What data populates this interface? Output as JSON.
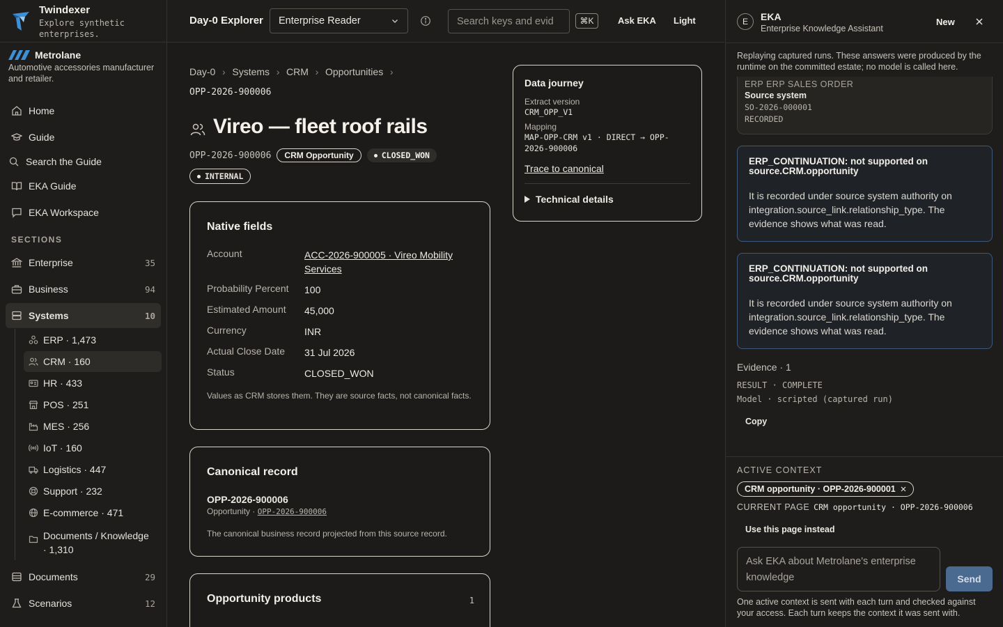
{
  "brand": {
    "name": "Twindexer",
    "tagline": "Explore synthetic enterprises."
  },
  "org": {
    "name": "Metrolane",
    "description": "Automotive accessories manufacturer and retailer."
  },
  "nav": {
    "home": "Home",
    "guide": "Guide",
    "search_guide": "Search the Guide",
    "eka_guide": "EKA Guide",
    "eka_workspace": "EKA Workspace",
    "sections_label": "SECTIONS",
    "enterprise": {
      "label": "Enterprise",
      "count": "35"
    },
    "business": {
      "label": "Business",
      "count": "94"
    },
    "systems": {
      "label": "Systems",
      "count": "10"
    },
    "documents": {
      "label": "Documents",
      "count": "29"
    },
    "scenarios": {
      "label": "Scenarios",
      "count": "12"
    },
    "systems_children": [
      {
        "label": "ERP · 1,473",
        "icon": "network-icon"
      },
      {
        "label": "CRM · 160",
        "icon": "users-icon"
      },
      {
        "label": "HR · 433",
        "icon": "id-card-icon"
      },
      {
        "label": "POS · 251",
        "icon": "store-icon"
      },
      {
        "label": "MES · 256",
        "icon": "factory-icon"
      },
      {
        "label": "IoT · 160",
        "icon": "signal-icon"
      },
      {
        "label": "Logistics · 447",
        "icon": "truck-icon"
      },
      {
        "label": "Support · 232",
        "icon": "lifebuoy-icon"
      },
      {
        "label": "E-commerce · 471",
        "icon": "globe-icon"
      },
      {
        "label": "Documents / Knowledge",
        "label2": "· 1,310",
        "icon": "folder-icon"
      }
    ]
  },
  "topbar": {
    "title": "Day-0 Explorer",
    "reader_select": "Enterprise Reader",
    "search_placeholder": "Search keys and evid",
    "shortcut": "⌘K",
    "ask_eka": "Ask EKA",
    "theme": "Light"
  },
  "breadcrumb": [
    "Day-0",
    "Systems",
    "CRM",
    "Opportunities"
  ],
  "record": {
    "id": "OPP-2026-900006",
    "title": "Vireo — fleet roof rails",
    "type_badge": "CRM Opportunity",
    "status_badge": "CLOSED_WON",
    "visibility_badge": "INTERNAL"
  },
  "native_fields": {
    "heading": "Native fields",
    "rows": [
      {
        "key": "Account",
        "value": "ACC-2026-900005 · Vireo Mobility Services"
      },
      {
        "key": "Probability Percent",
        "value": "100"
      },
      {
        "key": "Estimated Amount",
        "value": "45,000"
      },
      {
        "key": "Currency",
        "value": "INR"
      },
      {
        "key": "Actual Close Date",
        "value": "31 Jul 2026"
      },
      {
        "key": "Status",
        "value": "CLOSED_WON"
      }
    ],
    "note": "Values as CRM stores them. They are source facts, not canonical facts."
  },
  "canonical": {
    "heading": "Canonical record",
    "id": "OPP-2026-900006",
    "type_prefix": "Opportunity · ",
    "link": "OPP-2026-900006",
    "note": "The canonical business record projected from this source record."
  },
  "products": {
    "heading": "Opportunity products",
    "count": "1"
  },
  "journey": {
    "heading": "Data journey",
    "extract_label": "Extract version",
    "extract_value": "CRM_OPP_V1",
    "mapping_label": "Mapping",
    "mapping_value": "MAP-OPP-CRM v1 · DIRECT → OPP-2026-900006",
    "trace_link": "Trace to canonical",
    "technical": "Technical details"
  },
  "panel": {
    "avatar": "E",
    "title": "EKA",
    "subtitle": "Enterprise Knowledge Assistant",
    "new": "New",
    "notice": "Replaying captured runs. These answers were produced by the runtime on the committed estate; no model is called here.",
    "source_card": {
      "type": "ERP ERP SALES ORDER",
      "label": "Source system",
      "id": "SO-2026-000001",
      "state": "RECORDED"
    },
    "warnings": [
      {
        "title": "ERP_CONTINUATION: not supported on source.CRM.opportunity",
        "body": "It is recorded under source system authority on integration.source_link.relationship_type. The evidence shows what was read."
      },
      {
        "title": "ERP_CONTINUATION: not supported on source.CRM.opportunity",
        "body": "It is recorded under source system authority on integration.source_link.relationship_type. The evidence shows what was read."
      }
    ],
    "evidence_title": "Evidence · 1",
    "result_line": "RESULT · COMPLETE",
    "model_line": "Model · scripted (captured run)",
    "copy": "Copy",
    "active_context_label": "ACTIVE CONTEXT",
    "context_chip": "CRM opportunity · OPP-2026-900001",
    "current_page_label": "CURRENT PAGE",
    "current_page_value": "CRM opportunity · OPP-2026-900006",
    "use_page": "Use this page instead",
    "ask_placeholder": "Ask EKA about Metrolane's enterprise knowledge",
    "send": "Send",
    "footer_note": "One active context is sent with each turn and checked against your access. Each turn keeps the context it was sent with."
  }
}
